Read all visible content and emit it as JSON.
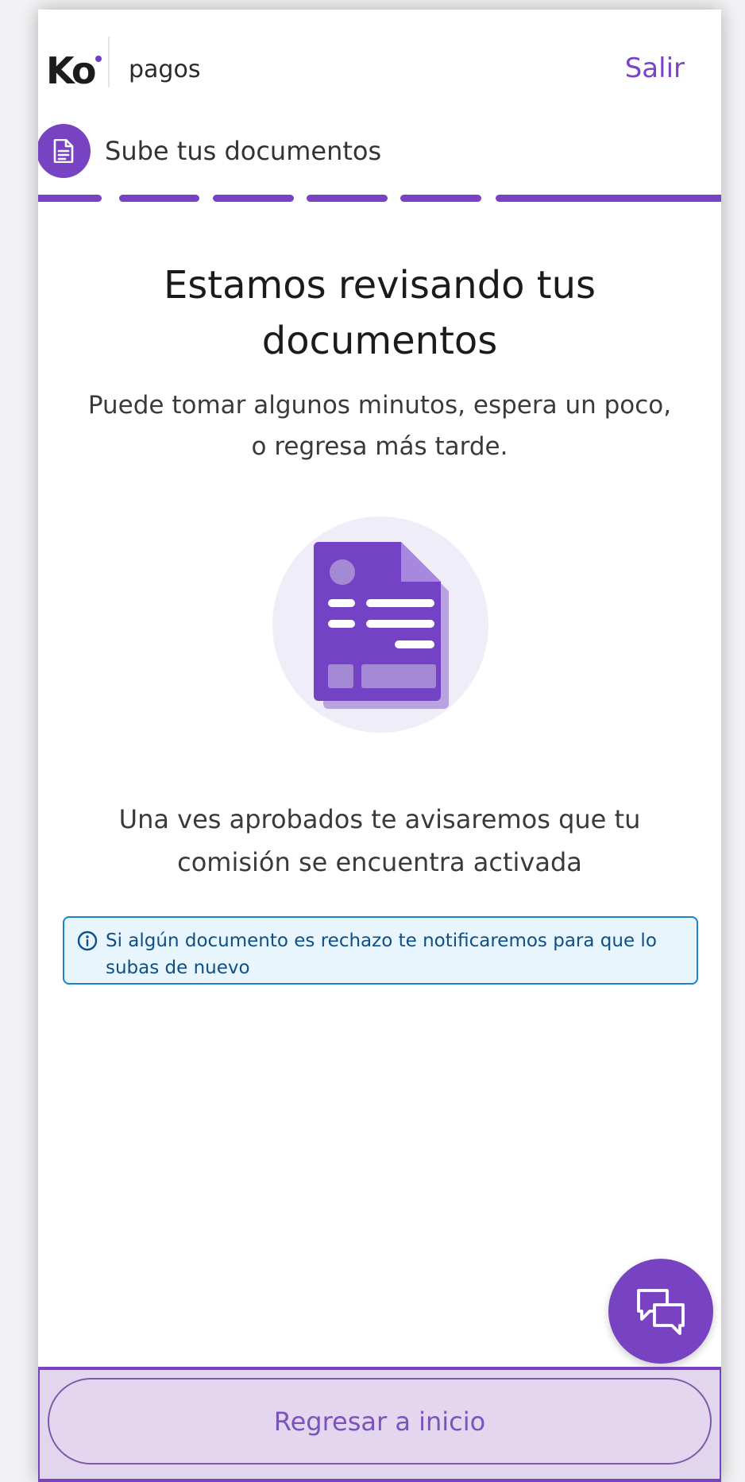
{
  "header": {
    "logo_text": "Ko",
    "product_name": "pagos",
    "exit_label": "Salir"
  },
  "step": {
    "icon": "document-icon",
    "title": "Sube tus documentos",
    "segments_total": 6,
    "segments_completed": 6
  },
  "main": {
    "heading_line1": "Estamos revisando tus",
    "heading_line2": "documentos",
    "subtitle_line1": "Puede tomar algunos minutos, espera un poco,",
    "subtitle_line2": "o regresa más tarde.",
    "illustration_icon": "document-review-icon",
    "approval_line1": "Una ves aprobados te avisaremos que tu",
    "approval_line2": "comisión se encuentra activada"
  },
  "info": {
    "icon": "info-icon",
    "text": "Si algún documento es rechazo te notificaremos para que lo subas de nuevo"
  },
  "chat": {
    "icon": "chat-icon"
  },
  "footer": {
    "home_button_label": "Regresar a inicio"
  },
  "colors": {
    "brand_purple": "#7743c2",
    "info_border": "#1c84c6",
    "info_background": "#e8f5fc",
    "footer_background": "#e2d5ee"
  }
}
